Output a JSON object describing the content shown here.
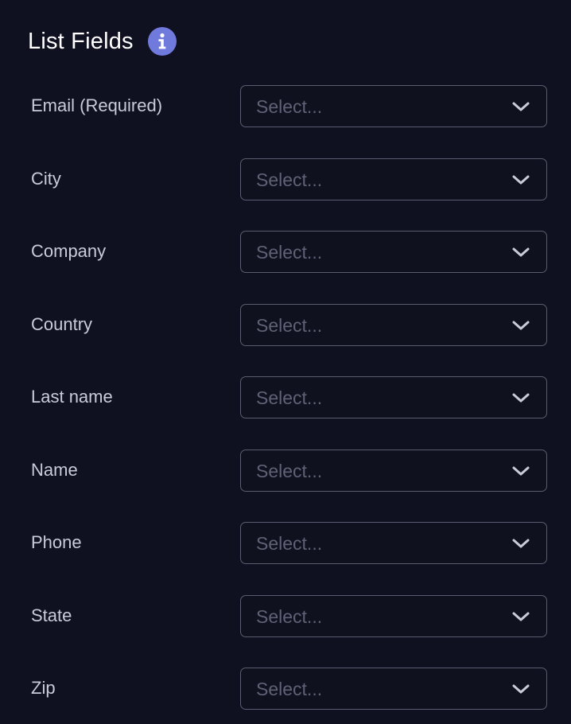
{
  "header": {
    "title": "List Fields",
    "info_icon": "info-icon"
  },
  "colors": {
    "background": "#0f1020",
    "accent": "#7079dc",
    "label": "#c9ccd8",
    "placeholder": "#5f6276",
    "border": "#5a5d70"
  },
  "fields": [
    {
      "label": "Email (Required)",
      "placeholder": "Select..."
    },
    {
      "label": "City",
      "placeholder": "Select..."
    },
    {
      "label": "Company",
      "placeholder": "Select..."
    },
    {
      "label": "Country",
      "placeholder": "Select..."
    },
    {
      "label": "Last name",
      "placeholder": "Select..."
    },
    {
      "label": "Name",
      "placeholder": "Select..."
    },
    {
      "label": "Phone",
      "placeholder": "Select..."
    },
    {
      "label": "State",
      "placeholder": "Select..."
    },
    {
      "label": "Zip",
      "placeholder": "Select..."
    }
  ]
}
